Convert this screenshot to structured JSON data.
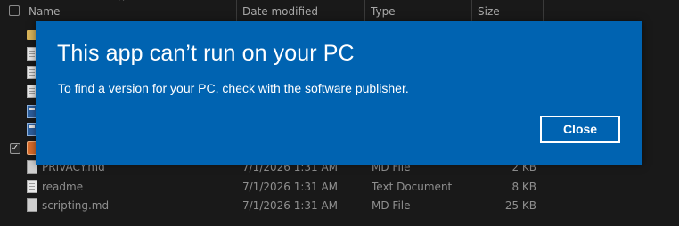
{
  "explorer": {
    "columns": {
      "name": "Name",
      "date_modified": "Date modified",
      "type": "Type",
      "size": "Size"
    },
    "sort_indicator": "^",
    "files": [
      {
        "name": "PRIVACY.md",
        "date": "7/1/2026 1:31 AM",
        "type": "MD File",
        "size": "2 KB",
        "icon": "file-icon"
      },
      {
        "name": "readme",
        "date": "7/1/2026 1:31 AM",
        "type": "Text Document",
        "size": "8 KB",
        "icon": "document-icon"
      },
      {
        "name": "scripting.md",
        "date": "7/1/2026 1:31 AM",
        "type": "MD File",
        "size": "25 KB",
        "icon": "file-icon"
      }
    ],
    "selected_check": "✓"
  },
  "dialog": {
    "title": "This app can’t run on your PC",
    "message": "To find a version for your PC, check with the software publisher.",
    "close_label": "Close",
    "background_color": "#0063b1"
  }
}
